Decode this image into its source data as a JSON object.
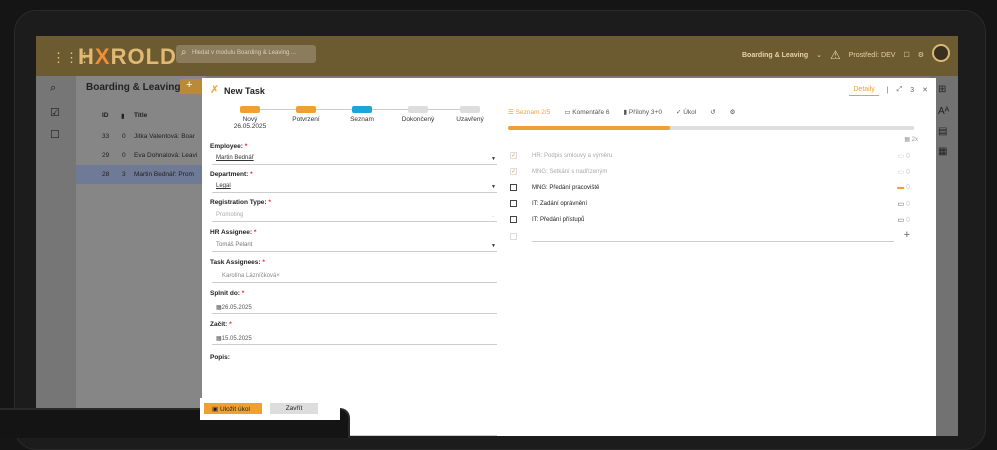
{
  "app": {
    "logo_prefix": "H",
    "logo_x": "X",
    "logo_suffix": "ROLD",
    "search_placeholder": "Hledat v modulu Boarding & Leaving ...",
    "module_name": "Boarding & Leaving",
    "env_label": "Prostředí: DEV"
  },
  "list": {
    "title": "Boarding & Leaving",
    "add_label": "+",
    "headers": {
      "id": "ID",
      "count": "",
      "title": "Title"
    },
    "rows": [
      {
        "id": "33",
        "count": "0",
        "title": "Jitka Valentová: Boar"
      },
      {
        "id": "29",
        "count": "0",
        "title": "Eva Dohnalová: Leavi"
      },
      {
        "id": "28",
        "count": "3",
        "title": "Martin Bednář: Prom"
      }
    ]
  },
  "modal": {
    "title": "New Task",
    "detaily": "Detaily",
    "count_indicator": "3",
    "steps": [
      {
        "label": "Nový",
        "date": "26.05.2025",
        "color": "#f0a030"
      },
      {
        "label": "Potvrzení",
        "date": "",
        "color": "#f0a030"
      },
      {
        "label": "Seznam",
        "date": "",
        "color": "#1aa7d8"
      },
      {
        "label": "Dokončený",
        "date": "",
        "color": "#dddddd"
      },
      {
        "label": "Uzavřený",
        "date": "",
        "color": "#dddddd"
      }
    ],
    "fields": {
      "employee_label": "Employee:",
      "employee_value": "Martin Bednář",
      "department_label": "Department:",
      "department_value": "Legal",
      "registration_label": "Registration Type:",
      "registration_value": "Promoting",
      "hr_label": "HR Assignee:",
      "hr_value": "Tomáš Pelant",
      "task_assignees_label": "Task Assignees:",
      "task_assignees_value": "Karolína Lázníčková×",
      "splnit_label": "Splnit do:",
      "splnit_value": "26.05.2025",
      "zacit_label": "Začít:",
      "zacit_value": "15.05.2025",
      "popis_label": "Popis:"
    },
    "required_mark": "*",
    "buttons": {
      "save": "Uložit úkol",
      "close": "Zavřít"
    }
  },
  "tabs": [
    {
      "label": "Seznam 2/5",
      "active": true
    },
    {
      "label": "Komentáře 6",
      "active": false
    },
    {
      "label": "Přílohy 3+0",
      "active": false
    },
    {
      "label": "✓ Úkol",
      "active": false
    },
    {
      "label": "↺",
      "active": false
    },
    {
      "label": "⚙",
      "active": false
    }
  ],
  "checklist": {
    "progress": 0.4,
    "summary": "2x",
    "items": [
      {
        "label": "HR: Podpis smlouvy a výměru",
        "done": true,
        "comments": "0"
      },
      {
        "label": "MNG: Setkání s nadřízeným",
        "done": true,
        "comments": "0"
      },
      {
        "label": "MNG: Předání pracoviště",
        "done": false,
        "comments": "0",
        "flag": true
      },
      {
        "label": "IT: Zadání oprávnění",
        "done": false,
        "comments": "0"
      },
      {
        "label": "IT: Předání přístupů",
        "done": false,
        "comments": "0"
      }
    ]
  }
}
